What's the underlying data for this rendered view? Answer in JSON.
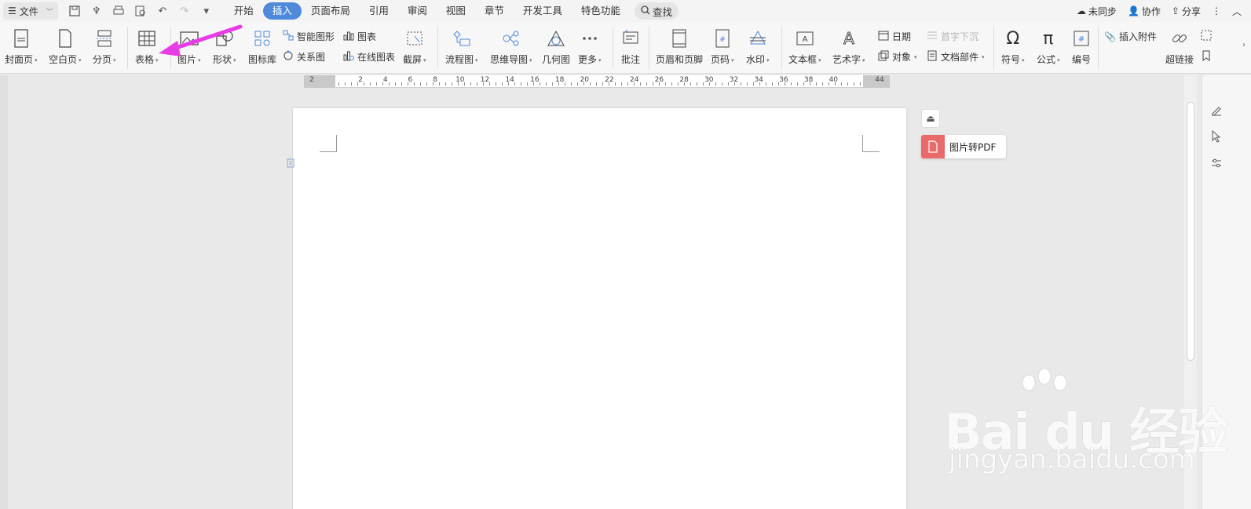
{
  "menubar": {
    "file_label": "文件",
    "tabs": [
      "开始",
      "插入",
      "页面布局",
      "引用",
      "审阅",
      "视图",
      "章节",
      "开发工具",
      "特色功能"
    ],
    "active_tab": "插入",
    "search_label": "查找",
    "unsynced_label": "未同步",
    "collab_label": "协作",
    "share_label": "分享"
  },
  "ribbon": {
    "cover": "封面页",
    "blank": "空白页",
    "pagebreak": "分页",
    "table": "表格",
    "picture": "图片",
    "shape": "形状",
    "iconlib": "图标库",
    "smartart": "智能图形",
    "chart": "图表",
    "relation": "关系图",
    "onlinechart": "在线图表",
    "screenshot": "截屏",
    "flowchart": "流程图",
    "mindmap": "思维导图",
    "geometry": "几何图",
    "more": "更多",
    "comment": "批注",
    "headerfooter": "页眉和页脚",
    "pagenum": "页码",
    "watermark": "水印",
    "textbox": "文本框",
    "wordart": "艺术字",
    "date": "日期",
    "object": "对象",
    "dropcap": "首字下沉",
    "docparts": "文档部件",
    "symbol": "符号",
    "formula": "公式",
    "numbering": "编号",
    "attachment": "插入附件",
    "hyperlink": "超链接"
  },
  "ruler": {
    "numbers": [
      "2",
      "2",
      "4",
      "6",
      "8",
      "10",
      "12",
      "14",
      "16",
      "18",
      "20",
      "22",
      "24",
      "26",
      "28",
      "30",
      "32",
      "34",
      "36",
      "38",
      "40",
      "44"
    ]
  },
  "side": {
    "pdf_label": "图片转PDF"
  },
  "watermark": {
    "logo": "Bai du 经验",
    "url": "jingyan.baidu.com"
  },
  "colors": {
    "accent": "#4f89d9",
    "arrow": "#e83ce6",
    "pdf": "#e96a6a"
  }
}
